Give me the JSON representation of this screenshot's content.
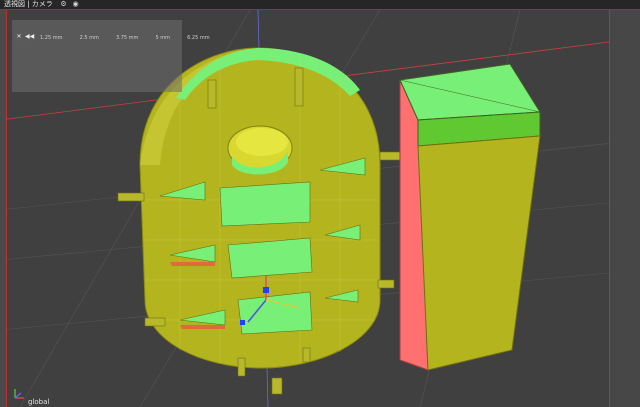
{
  "viewport": {
    "title": "透視図 | カメラ",
    "icons": [
      "settings-icon",
      "eye-icon"
    ],
    "overlay": {
      "buttons": [
        "✕",
        "◀◀"
      ],
      "units": [
        "1.25 mm",
        "2.5 mm",
        "3.75 mm",
        "5 mm",
        "6.25 mm"
      ]
    },
    "status": "global",
    "colors": {
      "background": "#404040",
      "cylinder": "#b4b41e",
      "highlight_face": "#78f078",
      "box_side": "#ff7070",
      "frame_accent": "#c02020"
    }
  }
}
